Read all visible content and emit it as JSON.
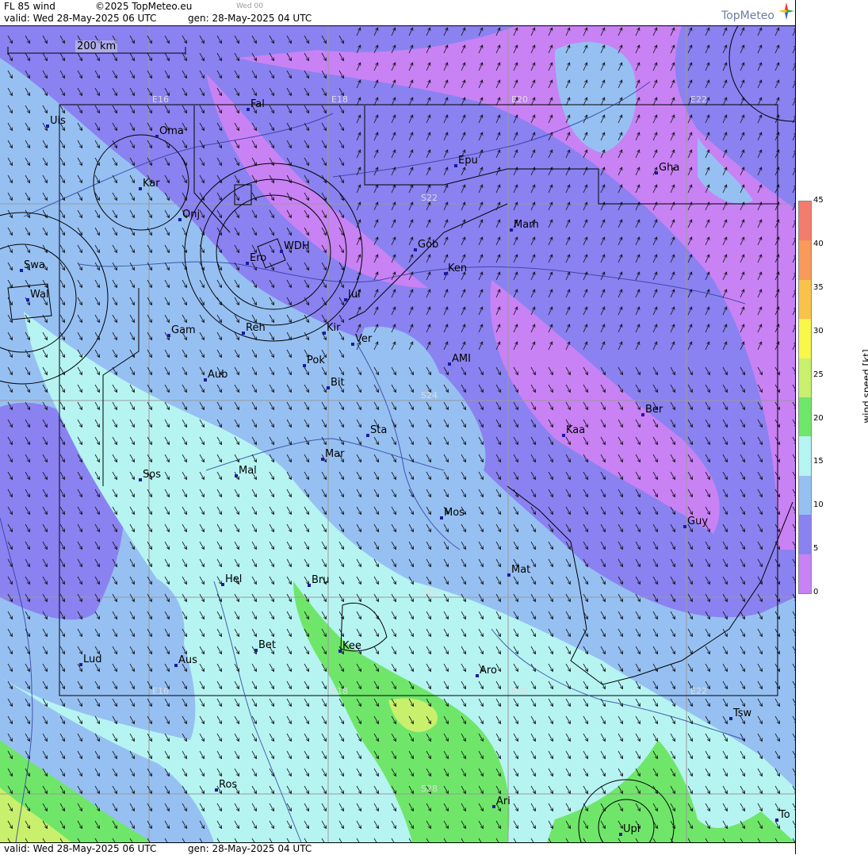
{
  "header": {
    "title": "FL 85 wind",
    "copyright": "©2025 TopMeteo.eu",
    "day": "Wed 00",
    "valid": "valid:  Wed  28-May-2025  06 UTC",
    "gen": "gen: 28-May-2025 04 UTC",
    "logo": "TopMeteo"
  },
  "footer": {
    "valid": "valid:  Wed  28-May-2025  06 UTC",
    "gen": "gen: 28-May-2025 04 UTC"
  },
  "scale_bar": "200 km",
  "grid_labels": {
    "lon_top": [
      "E16",
      "E18",
      "E20",
      "E22"
    ],
    "lon_bottom": [
      "E16",
      "E18",
      "E20",
      "E22"
    ],
    "lat": [
      "S22",
      "S24",
      "S26",
      "S28"
    ]
  },
  "places": [
    "Uis",
    "Oma",
    "Fal",
    "Epu",
    "Gha",
    "Kar",
    "Onj",
    "Mam",
    "Gob",
    "WDH",
    "Ken",
    "Ero",
    "Swa",
    "Wal",
    "Jul",
    "Gam",
    "Reh",
    "Kir",
    "Ver",
    "AMI",
    "Pok",
    "Aub",
    "Bit",
    "Ber",
    "Sta",
    "Kaa",
    "Mar",
    "Sos",
    "Mal",
    "Mos",
    "Guy",
    "Mat",
    "Hel",
    "Bru",
    "Kee",
    "Bet",
    "Lud",
    "Aus",
    "Aro",
    "Tsw",
    "Ros",
    "Ari",
    "To",
    "Upi"
  ],
  "legend": {
    "title": "wind speed [kt]",
    "ticks": [
      "45",
      "40",
      "35",
      "30",
      "25",
      "20",
      "15",
      "10",
      "5",
      "0"
    ],
    "colors": [
      "#f47c6c",
      "#f79a5a",
      "#f9c24a",
      "#f8f74a",
      "#c8f06c",
      "#6fe66a",
      "#b6f4f2",
      "#96c0f2",
      "#8a82f0",
      "#c882f4"
    ]
  }
}
